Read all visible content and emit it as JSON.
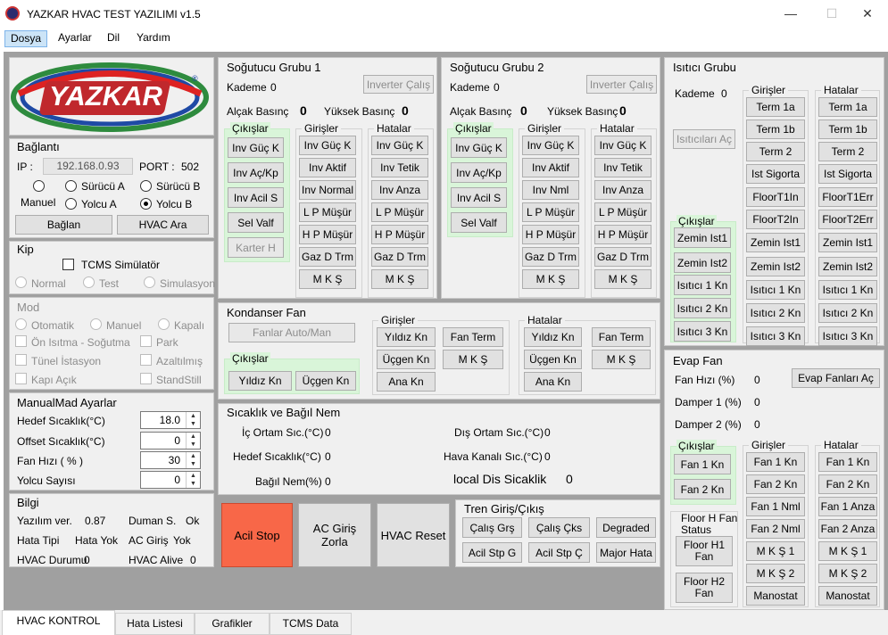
{
  "window": {
    "title": "YAZKAR HVAC TEST YAZILIMI v1.5",
    "minimize": "—",
    "maximize": "☐",
    "close": "✕"
  },
  "menu": [
    "Dosya",
    "Ayarlar",
    "Dil",
    "Yardım"
  ],
  "logo": {
    "text": "YAZKAR",
    "reg": "®"
  },
  "baglanti": {
    "title": "Bağlantı",
    "ip_label": "IP :",
    "ip": "192.168.0.93",
    "port_label": "PORT :",
    "port": "502",
    "surucu_a": "Sürücü A",
    "surucu_b": "Sürücü B",
    "manuel": "Manuel",
    "yolcu_a": "Yolcu A",
    "yolcu_b": "Yolcu B",
    "baglan": "Bağlan",
    "hvac_ara": "HVAC Ara"
  },
  "kip": {
    "title": "Kip",
    "tcms": "TCMS Simülatör",
    "normal": "Normal",
    "test": "Test",
    "sim": "Simulasyon"
  },
  "mod": {
    "title": "Mod",
    "otomatik": "Otomatik",
    "manuel": "Manuel",
    "kapali": "Kapalı",
    "on_isitma": "Ön Isıtma - Soğutma",
    "park": "Park",
    "tunel": "Tünel İstasyon",
    "azaltilmis": "Azaltılmış",
    "kapi": "Kapı Açık",
    "standstill": "StandStill"
  },
  "manual_mad": {
    "title": "ManualMad Ayarlar",
    "rows": [
      {
        "label": "Hedef Sıcaklık(°C)",
        "value": "18.0"
      },
      {
        "label": "Offset Sıcaklık(°C)",
        "value": "0"
      },
      {
        "label": "Fan Hızı ( % )",
        "value": "30"
      },
      {
        "label": "Yolcu Sayısı",
        "value": "0"
      }
    ]
  },
  "bilgi": {
    "title": "Bilgi",
    "yazilim_label": "Yazılım ver.",
    "yazilim": "0.87",
    "duman_label": "Duman S.",
    "duman": "Ok",
    "hata_tipi_label": "Hata Tipi",
    "hata_tipi": "Hata Yok",
    "ac_giris_label": "AC Giriş",
    "ac_giris": "Yok",
    "hvac_durumu_label": "HVAC Durumu",
    "hvac_durumu": "0",
    "hvac_alive_label": "HVAC Alive",
    "hvac_alive": "0"
  },
  "sg1": {
    "title": "Soğutucu Grubu 1",
    "kademe_label": "Kademe",
    "kademe": "0",
    "inverter": "Inverter Çalış",
    "alcak_label": "Alçak Basınç",
    "alcak": "0",
    "yuksek_label": "Yüksek Basınç",
    "yuksek": "0",
    "cikislar": "Çıkışlar",
    "girisler": "Girişler",
    "hatalar": "Hatalar",
    "out": [
      "Inv Güç K",
      "Inv Aç/Kp",
      "Inv Acil S",
      "Sel Valf",
      "Karter H"
    ],
    "in": [
      "Inv Güç K",
      "Inv Aktif",
      "Inv Normal",
      "L P Müşür",
      "H P Müşür",
      "Gaz D Trm",
      "M K Ş"
    ],
    "err": [
      "Inv Güç K",
      "Inv Tetik",
      "Inv Anza",
      "L P Müşür",
      "H P Müşür",
      "Gaz D Trm",
      "M K Ş"
    ]
  },
  "sg2": {
    "title": "Soğutucu Grubu 2",
    "kademe_label": "Kademe",
    "kademe": "0",
    "inverter": "Inverter Çalış",
    "alcak_label": "Alçak Basınç",
    "alcak": "0",
    "yuksek_label": "Yüksek Basınç",
    "yuksek": "0",
    "cikislar": "Çıkışlar",
    "girisler": "Girişler",
    "hatalar": "Hatalar",
    "out": [
      "Inv Güç K",
      "Inv Aç/Kp",
      "Inv Acil S",
      "Sel Valf"
    ],
    "in": [
      "Inv Güç K",
      "Inv Aktif",
      "Inv Nml",
      "L P Müşür",
      "H P Müşür",
      "Gaz D Trm",
      "M K Ş"
    ],
    "err": [
      "Inv Güç K",
      "Inv Tetik",
      "Inv Anza",
      "L P Müşür",
      "H P Müşür",
      "Gaz D Trm",
      "M K Ş"
    ]
  },
  "kondanser": {
    "title": "Kondanser Fan",
    "fanlar": "Fanlar Auto/Man",
    "cikislar": "Çıkışlar",
    "out": [
      "Yıldız Kn",
      "Üçgen Kn"
    ],
    "girisler": "Girişler",
    "in": [
      "Yıldız Kn",
      "Fan Term",
      "Üçgen Kn",
      "M K Ş",
      "Ana Kn"
    ],
    "hatalar": "Hatalar",
    "err": [
      "Yıldız Kn",
      "Fan Term",
      "Üçgen Kn",
      "M K Ş",
      "Ana Kn"
    ]
  },
  "sicaklik": {
    "title": "Sıcaklık ve Bağıl Nem",
    "ic_label": "İç Ortam Sıc.(°C)",
    "ic": "0",
    "dis_label": "Dış Ortam Sıc.(°C)",
    "dis": "0",
    "hedef_label": "Hedef Sıcaklık(°C)",
    "hedef": "0",
    "hava_label": "Hava Kanalı Sıc.(°C)",
    "hava": "0",
    "nem_label": "Bağıl Nem(%)",
    "nem": "0",
    "local_label": "local Dis Sicaklik",
    "local": "0"
  },
  "actions": {
    "acil_stop": "Acil Stop",
    "ac_giris": "AC Giriş\nZorla",
    "hvac_reset": "HVAC Reset",
    "acil_color": "#f86748"
  },
  "tren": {
    "title": "Tren Giriş/Çıkış",
    "btns": [
      "Çalış Grş",
      "Çalış Çks",
      "Degraded",
      "Acil Stp G",
      "Acil Stp Ç",
      "Major Hata"
    ]
  },
  "isitici": {
    "title": "Isıtıcı Grubu",
    "kademe_label": "Kademe",
    "kademe": "0",
    "ac": "Isıtıcıları Aç",
    "cikislar": "Çıkışlar",
    "out": [
      "Zemin Ist1",
      "Zemin Ist2",
      "Isıtıcı 1 Kn",
      "Isıtıcı 2 Kn",
      "Isıtıcı 3 Kn"
    ],
    "girisler": "Girişler",
    "in": [
      "Term 1a",
      "Term 1b",
      "Term 2",
      "Ist Sigorta",
      "FloorT1In",
      "FloorT2In",
      "Zemin Ist1",
      "Zemin Ist2",
      "Isıtıcı 1 Kn",
      "Isıtıcı 2 Kn",
      "Isıtıcı 3 Kn"
    ],
    "hatalar": "Hatalar",
    "err": [
      "Term 1a",
      "Term 1b",
      "Term 2",
      "Ist Sigorta",
      "FloorT1Err",
      "FloorT2Err",
      "Zemin Ist1",
      "Zemin Ist2",
      "Isıtıcı 1 Kn",
      "Isıtıcı 2 Kn",
      "Isıtıcı 3 Kn"
    ]
  },
  "evap": {
    "title": "Evap Fan",
    "fan_label": "Fan Hızı (%)",
    "fan": "0",
    "d1_label": "Damper 1 (%)",
    "d1": "0",
    "d2_label": "Damper 2 (%)",
    "d2": "0",
    "ac": "Evap Fanları Aç",
    "cikislar": "Çıkışlar",
    "out": [
      "Fan 1 Kn",
      "Fan 2 Kn"
    ],
    "floor_status": "Floor H Fan\nStatus",
    "floor": [
      "Floor H1\nFan",
      "Floor H2\nFan"
    ],
    "girisler": "Girişler",
    "in": [
      "Fan 1 Kn",
      "Fan 2 Kn",
      "Fan 1 Nml",
      "Fan 2 Nml",
      "M K Ş 1",
      "M K Ş 2",
      "Manostat"
    ],
    "hatalar": "Hatalar",
    "err": [
      "Fan 1 Kn",
      "Fan 2 Kn",
      "Fan 1 Anza",
      "Fan 2 Anza",
      "M K Ş 1",
      "M K Ş 2",
      "Manostat"
    ]
  },
  "tabs": [
    "HVAC KONTROL",
    "Hata Listesi",
    "Grafikler",
    "TCMS Data"
  ],
  "colors": {
    "green": "#d9f5d9",
    "form_bg": "#a0a0a0",
    "panel": "#f0f0f0"
  }
}
